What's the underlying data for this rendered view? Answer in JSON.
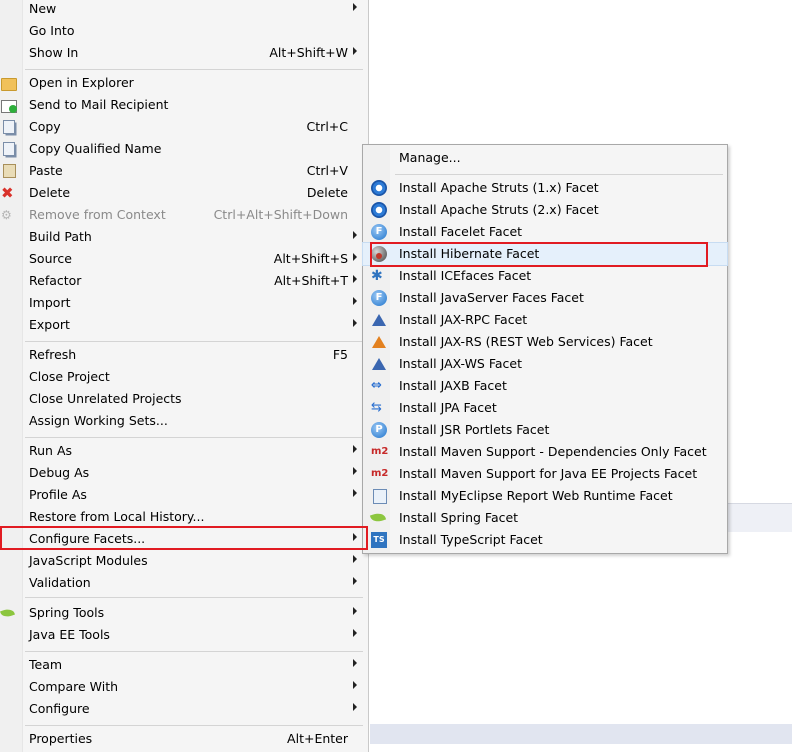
{
  "context_menu": {
    "items": [
      {
        "label": "New",
        "shortcut": "",
        "submenu": true,
        "icon": "",
        "disabled": false
      },
      {
        "label": "Go Into",
        "shortcut": "",
        "submenu": false,
        "icon": "",
        "disabled": false
      },
      {
        "label": "Show In",
        "shortcut": "Alt+Shift+W",
        "submenu": true,
        "icon": "",
        "disabled": false
      },
      {
        "label": "Open in Explorer",
        "shortcut": "",
        "submenu": false,
        "icon": "folder-icon",
        "disabled": false
      },
      {
        "label": "Send to Mail Recipient",
        "shortcut": "",
        "submenu": false,
        "icon": "mail-icon",
        "disabled": false
      },
      {
        "label": "Copy",
        "shortcut": "Ctrl+C",
        "submenu": false,
        "icon": "copy-icon",
        "disabled": false
      },
      {
        "label": "Copy Qualified Name",
        "shortcut": "",
        "submenu": false,
        "icon": "copy-icon",
        "disabled": false
      },
      {
        "label": "Paste",
        "shortcut": "Ctrl+V",
        "submenu": false,
        "icon": "paste-icon",
        "disabled": false
      },
      {
        "label": "Delete",
        "shortcut": "Delete",
        "submenu": false,
        "icon": "delete-icon",
        "disabled": false
      },
      {
        "label": "Remove from Context",
        "shortcut": "Ctrl+Alt+Shift+Down",
        "submenu": false,
        "icon": "remove-context-icon",
        "disabled": true
      },
      {
        "label": "Build Path",
        "shortcut": "",
        "submenu": true,
        "icon": "",
        "disabled": false
      },
      {
        "label": "Source",
        "shortcut": "Alt+Shift+S",
        "submenu": true,
        "icon": "",
        "disabled": false
      },
      {
        "label": "Refactor",
        "shortcut": "Alt+Shift+T",
        "submenu": true,
        "icon": "",
        "disabled": false
      },
      {
        "label": "Import",
        "shortcut": "",
        "submenu": true,
        "icon": "",
        "disabled": false
      },
      {
        "label": "Export",
        "shortcut": "",
        "submenu": true,
        "icon": "",
        "disabled": false
      },
      {
        "label": "Refresh",
        "shortcut": "F5",
        "submenu": false,
        "icon": "",
        "disabled": false
      },
      {
        "label": "Close Project",
        "shortcut": "",
        "submenu": false,
        "icon": "",
        "disabled": false
      },
      {
        "label": "Close Unrelated Projects",
        "shortcut": "",
        "submenu": false,
        "icon": "",
        "disabled": false
      },
      {
        "label": "Assign Working Sets...",
        "shortcut": "",
        "submenu": false,
        "icon": "",
        "disabled": false
      },
      {
        "label": "Run As",
        "shortcut": "",
        "submenu": true,
        "icon": "",
        "disabled": false
      },
      {
        "label": "Debug As",
        "shortcut": "",
        "submenu": true,
        "icon": "",
        "disabled": false
      },
      {
        "label": "Profile As",
        "shortcut": "",
        "submenu": true,
        "icon": "",
        "disabled": false
      },
      {
        "label": "Restore from Local History...",
        "shortcut": "",
        "submenu": false,
        "icon": "",
        "disabled": false
      },
      {
        "label": "Configure Facets...",
        "shortcut": "",
        "submenu": true,
        "icon": "",
        "disabled": false
      },
      {
        "label": "JavaScript Modules",
        "shortcut": "",
        "submenu": true,
        "icon": "",
        "disabled": false
      },
      {
        "label": "Validation",
        "shortcut": "",
        "submenu": true,
        "icon": "",
        "disabled": false
      },
      {
        "label": "Spring Tools",
        "shortcut": "",
        "submenu": true,
        "icon": "spring-leaf-icon",
        "disabled": false
      },
      {
        "label": "Java EE Tools",
        "shortcut": "",
        "submenu": true,
        "icon": "",
        "disabled": false
      },
      {
        "label": "Team",
        "shortcut": "",
        "submenu": true,
        "icon": "",
        "disabled": false
      },
      {
        "label": "Compare With",
        "shortcut": "",
        "submenu": true,
        "icon": "",
        "disabled": false
      },
      {
        "label": "Configure",
        "shortcut": "",
        "submenu": true,
        "icon": "",
        "disabled": false
      },
      {
        "label": "Properties",
        "shortcut": "Alt+Enter",
        "submenu": false,
        "icon": "",
        "disabled": false
      }
    ]
  },
  "facets_submenu": {
    "items": [
      {
        "label": "Manage...",
        "icon": ""
      },
      {
        "label": "Install Apache Struts (1.x) Facet",
        "icon": "struts-gear-icon"
      },
      {
        "label": "Install Apache Struts (2.x) Facet",
        "icon": "struts-gear-icon"
      },
      {
        "label": "Install Facelet Facet",
        "icon": "facelet-icon"
      },
      {
        "label": "Install Hibernate Facet",
        "icon": "hibernate-icon"
      },
      {
        "label": "Install ICEfaces Facet",
        "icon": "icefaces-icon"
      },
      {
        "label": "Install JavaServer Faces Facet",
        "icon": "jsf-icon"
      },
      {
        "label": "Install JAX-RPC Facet",
        "icon": "jax-rpc-icon"
      },
      {
        "label": "Install JAX-RS (REST Web Services) Facet",
        "icon": "jax-rs-icon"
      },
      {
        "label": "Install JAX-WS Facet",
        "icon": "jax-ws-icon"
      },
      {
        "label": "Install JAXB Facet",
        "icon": "jaxb-icon"
      },
      {
        "label": "Install JPA Facet",
        "icon": "jpa-icon"
      },
      {
        "label": "Install JSR Portlets Facet",
        "icon": "portlet-icon"
      },
      {
        "label": "Install Maven Support - Dependencies Only Facet",
        "icon": "maven-m2-icon"
      },
      {
        "label": "Install Maven Support for Java EE Projects Facet",
        "icon": "maven-m2-icon"
      },
      {
        "label": "Install MyEclipse Report Web Runtime Facet",
        "icon": "report-icon"
      },
      {
        "label": "Install Spring Facet",
        "icon": "spring-leaf-icon"
      },
      {
        "label": "Install TypeScript Facet",
        "icon": "typescript-icon"
      }
    ]
  },
  "highlight_color": "#e11b22",
  "hover_color": "#e5f0fb"
}
